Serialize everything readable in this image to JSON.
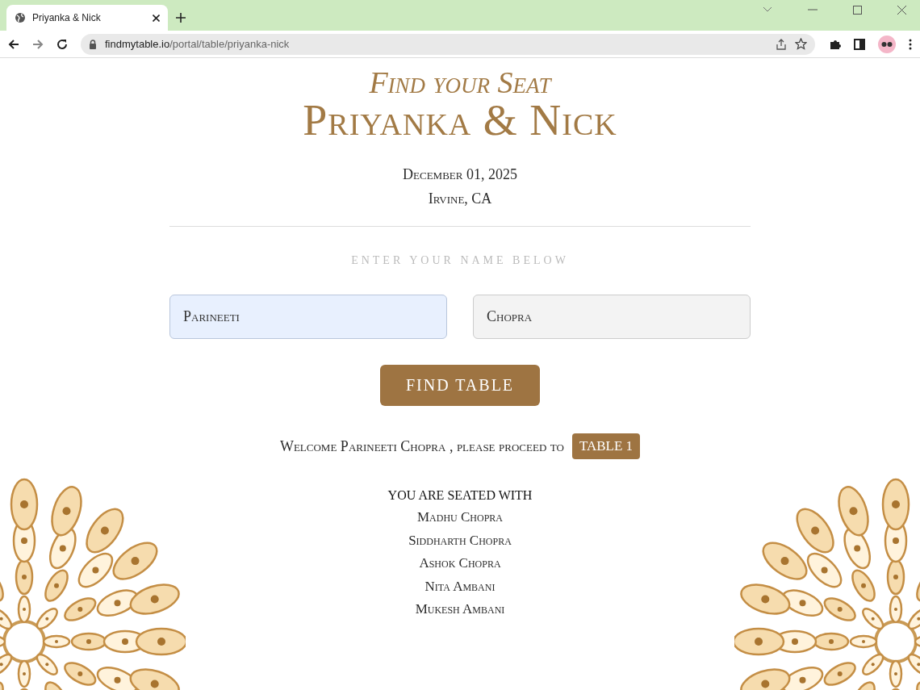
{
  "browser": {
    "tab_title": "Priyanka & Nick",
    "url_host": "findmytable.io",
    "url_path": "/portal/table/priyanka-nick"
  },
  "header": {
    "subtitle": "Find your Seat",
    "title": "Priyanka & Nick",
    "date": "December 01, 2025",
    "location": "Irvine, CA"
  },
  "form": {
    "prompt": "ENTER YOUR NAME BELOW",
    "first_name": {
      "value": "Parineeti",
      "autofilled": true
    },
    "last_name": {
      "value": "Chopra",
      "autofilled": false
    },
    "button": "FIND TABLE"
  },
  "result": {
    "message": "Welcome Parineeti Chopra , please proceed to",
    "table": "TABLE 1",
    "seated_heading": "YOU ARE SEATED WITH",
    "guests": [
      "Madhu Chopra",
      "Siddharth Chopra",
      "Ashok Chopra",
      "Nita Ambani",
      "Mukesh Ambani"
    ]
  }
}
